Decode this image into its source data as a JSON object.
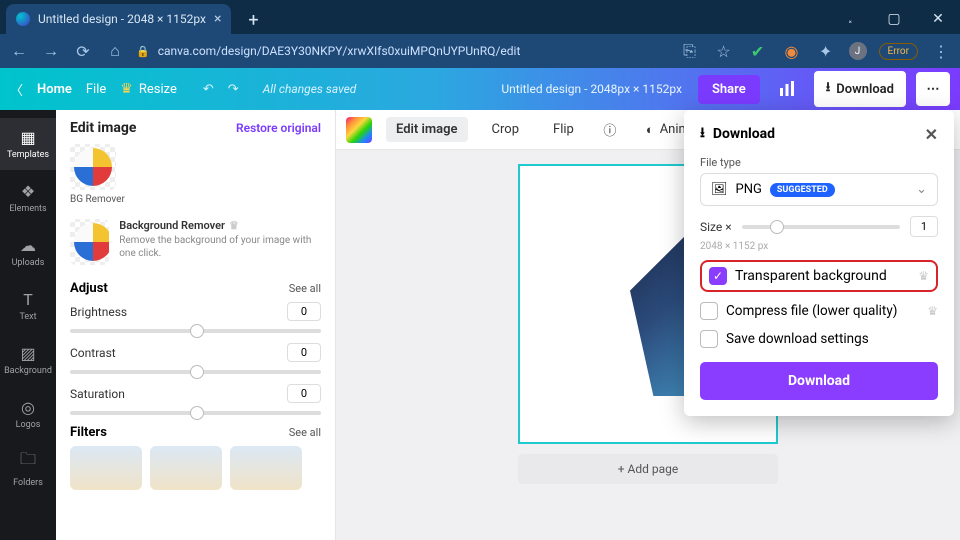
{
  "browser": {
    "tab_title": "Untitled design - 2048 × 1152px",
    "url": "canva.com/design/DAE3Y30NKPY/xrwXIfs0xuiMPQnUYPUnRQ/edit",
    "error_label": "Error",
    "avatar_initial": "J"
  },
  "toolbar": {
    "home": "Home",
    "file": "File",
    "resize": "Resize",
    "status": "All changes saved",
    "doc_title": "Untitled design - 2048px × 1152px",
    "share": "Share",
    "download": "Download"
  },
  "leftnav": {
    "items": [
      {
        "label": "Templates",
        "icon": "⊞"
      },
      {
        "label": "Elements",
        "icon": "❖"
      },
      {
        "label": "Uploads",
        "icon": "☁"
      },
      {
        "label": "Text",
        "icon": "T"
      },
      {
        "label": "Background",
        "icon": "▨"
      },
      {
        "label": "Logos",
        "icon": "◎"
      },
      {
        "label": "Folders",
        "icon": "🗀"
      }
    ]
  },
  "edit_panel": {
    "title": "Edit image",
    "restore": "Restore original",
    "bg_remover_label": "BG Remover",
    "bg_remover_app": {
      "name": "Background Remover",
      "desc": "Remove the background of your image with one click."
    },
    "adjust": {
      "title": "Adjust",
      "see_all": "See all"
    },
    "sliders": {
      "brightness": {
        "label": "Brightness",
        "value": "0"
      },
      "contrast": {
        "label": "Contrast",
        "value": "0"
      },
      "saturation": {
        "label": "Saturation",
        "value": "0"
      }
    },
    "filters": {
      "title": "Filters",
      "see_all": "See all"
    }
  },
  "canvas_toolbar": {
    "edit_image": "Edit image",
    "crop": "Crop",
    "flip": "Flip",
    "animate": "Animate"
  },
  "canvas": {
    "add_page": "+ Add page"
  },
  "download_panel": {
    "title": "Download",
    "file_type_label": "File type",
    "file_type_value": "PNG",
    "suggested": "SUGGESTED",
    "size_label": "Size ×",
    "size_value": "1",
    "dims": "2048 × 1152 px",
    "transparent_bg": "Transparent background",
    "compress": "Compress file (lower quality)",
    "save_settings": "Save download settings",
    "download_btn": "Download"
  }
}
